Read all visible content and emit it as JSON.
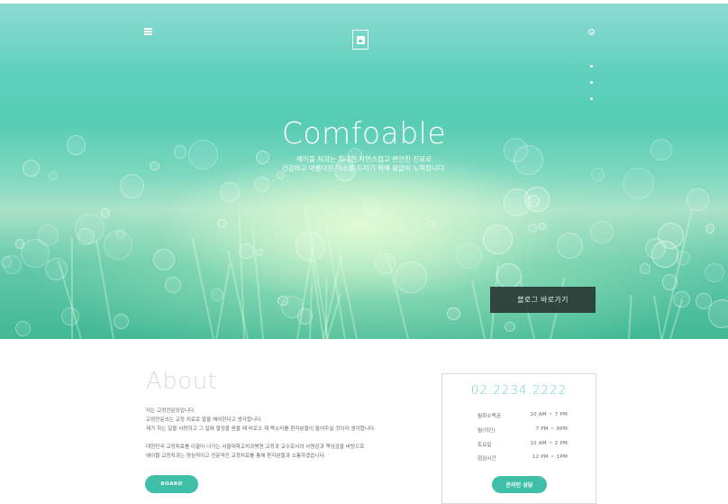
{
  "hero": {
    "title": "Comfoable",
    "subtitle_line1": "예이블 치과는 최대한 자연스럽고 편안한 진료로",
    "subtitle_line2": "건강하고 아름다운 미소를 드리기 위해 쉼없이 노력합니다.",
    "blog_button_label": "블로그 바로가기",
    "logo_letter": "a"
  },
  "about": {
    "title": "About",
    "paragraph1": [
      "저는 교정전문의입니다.",
      "교정전문의는 교정 치료로 말을 해야한다고 생각합니다.",
      "제가 하는 일을 사랑하고 그 일에 열정을 쏟을 때 비로소 제 목소리를 환자분들이 들어주실 것이라 생각합니다."
    ],
    "paragraph2": [
      "대한민국 교정치료를 이끌어 나가는 서울대학교치과병원 교정과 교수로서의 사명감과 책임감을 바탕으로",
      "에이블 교정치과는 양심적이고 전문적인 교정치료를 통해 환자분들과 소통하겠습니다."
    ],
    "board_button_label": "BOARD"
  },
  "contact": {
    "phone": "02.2234.2222",
    "hours": [
      {
        "day": "월화수목금",
        "time": "10 AM  ~  7 PM"
      },
      {
        "day": "월(야간)",
        "time": "7 PM  ~  9PM"
      },
      {
        "day": "토요일",
        "time": "10 AM  ~  2 PM"
      },
      {
        "day": "점심시간",
        "time": "12 PM  ~  1PM"
      }
    ],
    "consult_button_label": "온라인 상담"
  },
  "colors": {
    "accent": "#3fbfa8",
    "phone_text": "#6fd2c4",
    "dark_button": "#283a34"
  }
}
